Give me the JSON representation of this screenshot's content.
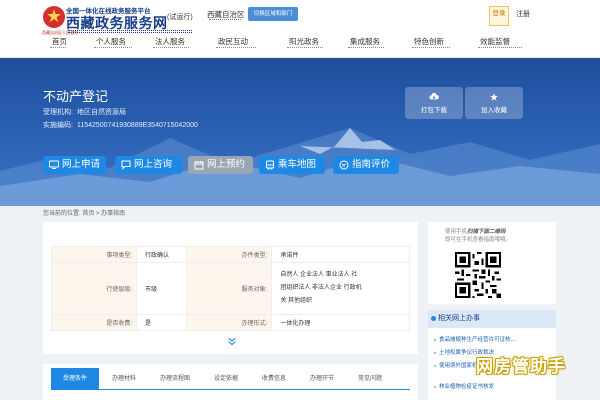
{
  "header": {
    "logo_sub": "全国一体化在线政务服务平台",
    "logo_main": "西藏政务服务网",
    "emblem_caption": "西藏自治区人民政府",
    "trial_label": "(试运行)",
    "region_label": "西藏自治区",
    "switch_label": "切换区域和部门",
    "login_label": "登录",
    "register_label": "注册"
  },
  "nav": {
    "items": [
      {
        "label": "首页"
      },
      {
        "label": "个人服务"
      },
      {
        "label": "法人服务"
      },
      {
        "label": "政民互动"
      },
      {
        "label": "阳光政务"
      },
      {
        "label": "集成服务"
      },
      {
        "label": "特色创新"
      },
      {
        "label": "效能监督"
      }
    ]
  },
  "hero": {
    "title": "不动产登记",
    "agency_label": "受理机构:",
    "agency_value": "地区自然资源局",
    "code_label": "实施编码:",
    "code_value": "11542500741930889E3540715042000",
    "actions": [
      {
        "label": "打包下载",
        "icon": "cloud-download-icon"
      },
      {
        "label": "加入收藏",
        "icon": "star-icon"
      }
    ],
    "services": [
      {
        "label": "网上申请",
        "icon": "computer-icon"
      },
      {
        "label": "网上咨询",
        "icon": "chat-icon"
      },
      {
        "label": "网上预约",
        "icon": "calendar-icon"
      },
      {
        "label": "乘车地图",
        "icon": "bus-icon"
      },
      {
        "label": "指南评价",
        "icon": "comment-icon"
      }
    ]
  },
  "breadcrumb": {
    "text": "您当前的位置: 首页 > 办事指南"
  },
  "details": {
    "rows": [
      {
        "k1": "事项类型:",
        "v1": "行政确认",
        "k2": "办件类型:",
        "v2": "承诺件"
      },
      {
        "k1": "行使层级:",
        "v1": "市级",
        "k2": "服务对象:",
        "v2_lines": [
          "自然人 企业法人 事业法人 社",
          "团组织法人 非法人企业 行政机",
          "关 其他组织"
        ]
      },
      {
        "k1": "是否收费:",
        "v1": "是",
        "k2": "办理形式:",
        "v2": "一体化办理"
      }
    ]
  },
  "tabs": {
    "items": [
      {
        "label": "受理条件",
        "active": true
      },
      {
        "label": "办理材料",
        "active": false
      },
      {
        "label": "办理流程图",
        "active": false
      },
      {
        "label": "设定依据",
        "active": false
      },
      {
        "label": "收费信息",
        "active": false
      },
      {
        "label": "办理环节",
        "active": false
      },
      {
        "label": "常见问题",
        "active": false
      }
    ]
  },
  "qr_panel": {
    "line1_prefix": "使用手机",
    "line1_bold": "扫描下面二维码",
    "line2": "即可在手机查看指南哦哦。"
  },
  "related": {
    "title": "相关网上办事",
    "items": [
      "食品摊贩种生产经营许可证核...",
      "土地权属争议行政裁决",
      "使用境外国家机构...",
      "林业植物检疫证书核发"
    ]
  },
  "watermark": {
    "text": "网房管助手"
  },
  "colors": {
    "brand_blue": "#1e88e5",
    "hero_blue": "#2c62b4",
    "logo_navy": "#1a3e8c",
    "login_gold": "#f1c25a",
    "key_cell_bg": "#fdf6ec"
  }
}
